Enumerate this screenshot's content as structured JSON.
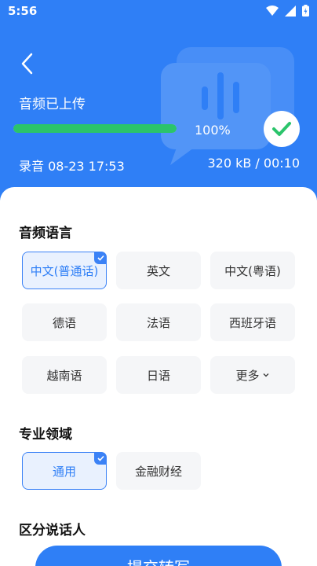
{
  "status_bar": {
    "time": "5:56"
  },
  "header": {
    "upload_title": "音频已上传",
    "progress": {
      "value": 1.0,
      "label": "100%"
    },
    "record_label": "录音 08-23 17:53",
    "record_meta": "320 kB / 00:10"
  },
  "sections": {
    "language_title": "音频语言",
    "domain_title": "专业领域",
    "speaker_title": "区分说话人"
  },
  "languages": [
    {
      "label": "中文(普通话)",
      "selected": true
    },
    {
      "label": "英文",
      "selected": false
    },
    {
      "label": "中文(粤语)",
      "selected": false
    },
    {
      "label": "德语",
      "selected": false
    },
    {
      "label": "法语",
      "selected": false
    },
    {
      "label": "西班牙语",
      "selected": false
    },
    {
      "label": "越南语",
      "selected": false
    },
    {
      "label": "日语",
      "selected": false
    },
    {
      "label": "更多",
      "selected": false
    }
  ],
  "domains": [
    {
      "label": "通用",
      "selected": true
    },
    {
      "label": "金融财经",
      "selected": false
    }
  ],
  "submit_label": "提交转写",
  "colors": {
    "primary": "#2f7ff6",
    "success": "#2bc46b"
  }
}
